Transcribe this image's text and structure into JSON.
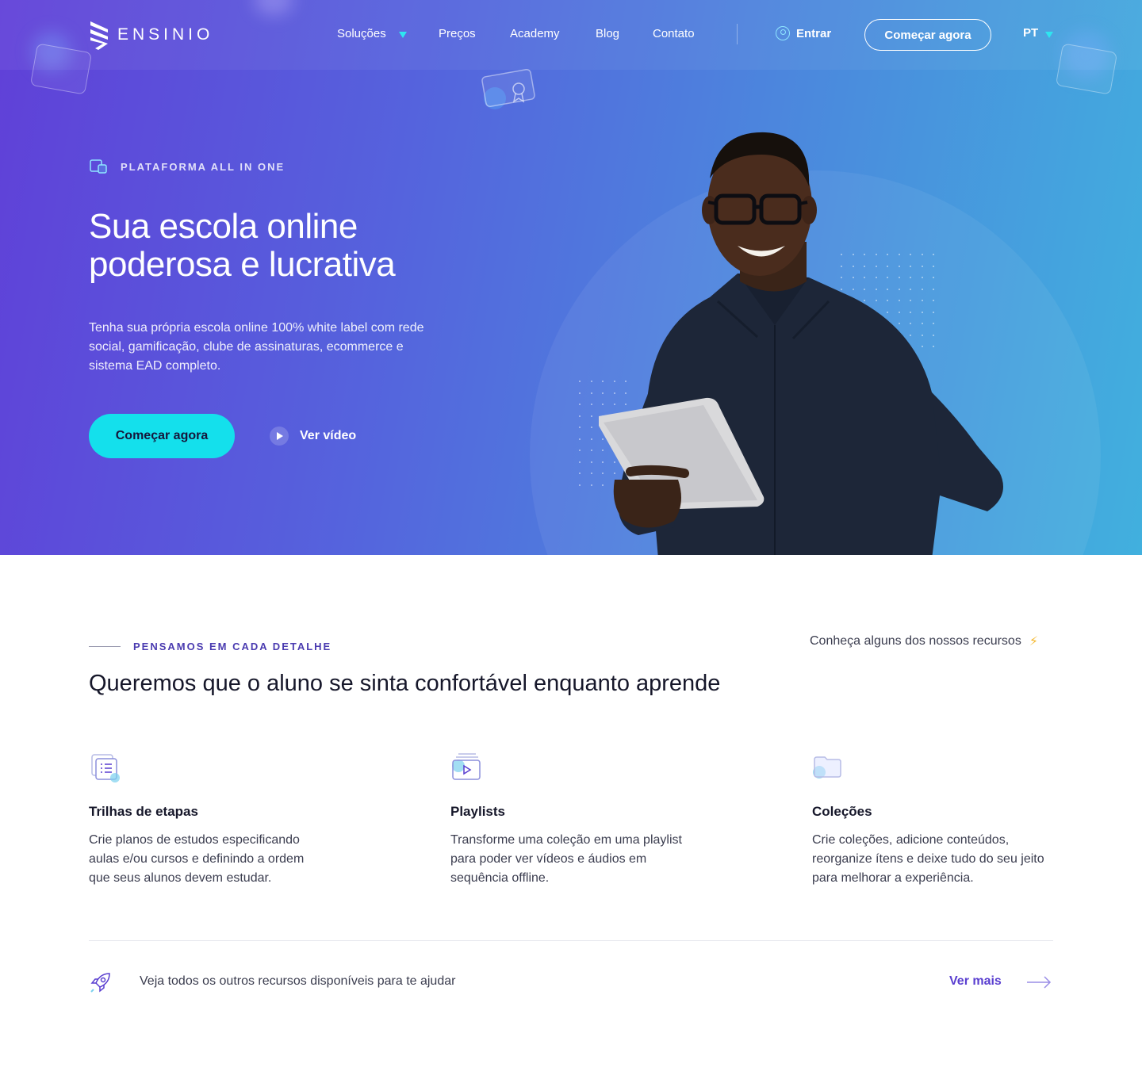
{
  "brand": {
    "name": "ENSINIO",
    "logo_icon": "ensinio-logo-icon"
  },
  "nav": {
    "items": [
      {
        "label": "Soluções",
        "has_dropdown": true
      },
      {
        "label": "Preços"
      },
      {
        "label": "Academy"
      },
      {
        "label": "Blog"
      },
      {
        "label": "Contato"
      }
    ],
    "login_label": "Entrar",
    "cta_label": "Começar agora",
    "language": "PT"
  },
  "hero": {
    "eyebrow": "PLATAFORMA ALL IN ONE",
    "title_line1": "Sua escola online",
    "title_line2": "poderosa e lucrativa",
    "description": "Tenha sua própria escola online 100% white label com rede social, gamificação, clube de assinaturas, ecommerce e sistema EAD completo.",
    "cta_label": "Começar agora",
    "video_label": "Ver vídeo"
  },
  "features_section": {
    "eyebrow": "PENSAMOS EM CADA DETALHE",
    "side_note": "Conheça alguns dos nossos recursos",
    "title": "Queremos que o aluno se sinta confortável enquanto aprende",
    "items": [
      {
        "icon": "list-steps-icon",
        "title": "Trilhas de etapas",
        "description": "Crie planos de estudos especificando aulas e/ou cursos e definindo a ordem que seus alunos devem estudar."
      },
      {
        "icon": "playlist-icon",
        "title": "Playlists",
        "description": "Transforme uma coleção em uma playlist para poder ver vídeos e áudios em sequência offline."
      },
      {
        "icon": "folder-icon",
        "title": "Coleções",
        "description": "Crie coleções, adicione conteúdos, reorganize ítens e deixe tudo do seu jeito para melhorar a experiência."
      }
    ],
    "footer_text": "Veja todos os outros recursos disponíveis para te ajudar",
    "footer_link": "Ver mais"
  },
  "colors": {
    "hero_gradient_start": "#6040d8",
    "hero_gradient_end": "#41b0de",
    "accent_cyan": "#14e0ec",
    "link_purple": "#5a3fd0",
    "eyebrow_purple": "#4a3bb0"
  }
}
